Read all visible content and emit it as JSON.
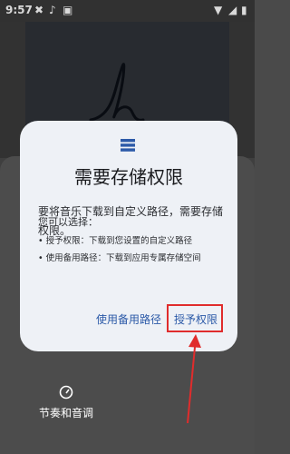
{
  "status_bar": {
    "time": "9:57",
    "colors": {
      "icon": "#ffffff"
    }
  },
  "background": {
    "bottom_tab_label": "节奏和音调"
  },
  "dialog": {
    "title": "需要存储权限",
    "message": "要将音乐下载到自定义路径，需要存储权限。",
    "options_heading": "您可以选择：",
    "options": [
      "• 授予权限：下载到您设置的自定义路径",
      "• 使用备用路径：下载到应用专属存储空间"
    ],
    "buttons": {
      "use_alternate_path": "使用备用路径",
      "grant_permission": "授予权限"
    },
    "colors": {
      "background": "#eef1f6",
      "button_text": "#2c5aa8",
      "title": "#1b1c1f"
    }
  },
  "annotation": {
    "highlight_color": "#e02c2c",
    "target": "grant_permission"
  }
}
